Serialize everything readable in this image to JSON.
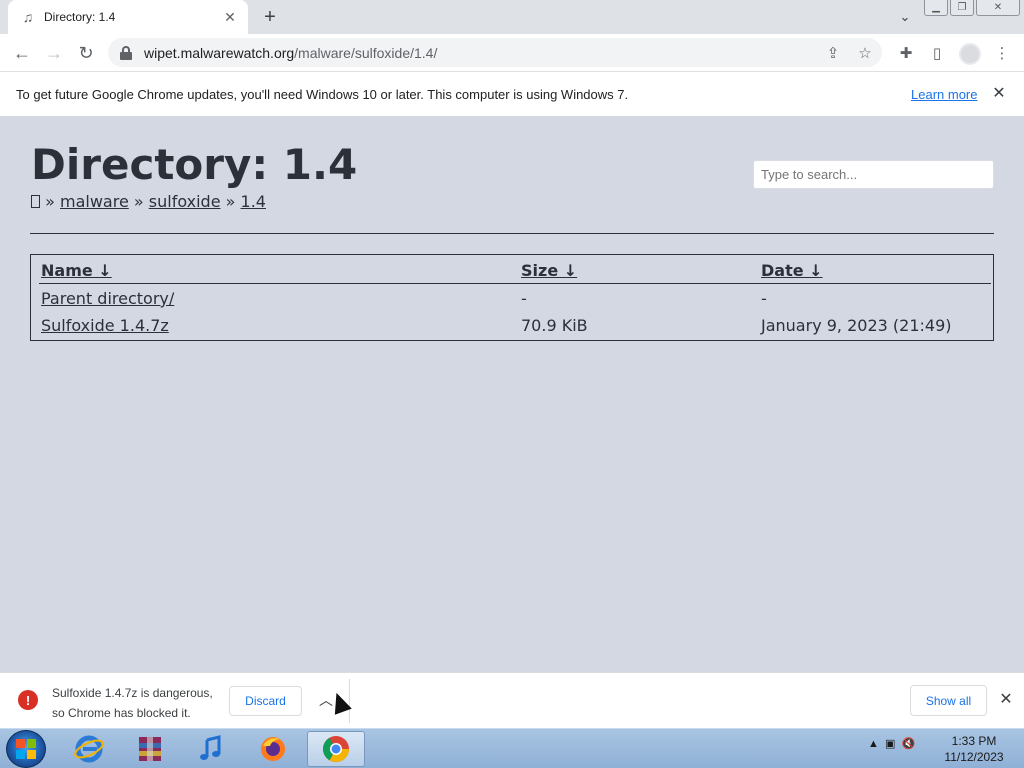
{
  "browser": {
    "tab": {
      "title": "Directory: 1.4"
    },
    "url": {
      "host": "wipet.malwarewatch.org",
      "path": "/malware/sulfoxide/1.4/"
    }
  },
  "infobar": {
    "message": "To get future Google Chrome updates, you'll need Windows 10 or later. This computer is using Windows 7.",
    "link": "Learn more"
  },
  "page": {
    "title": "Directory: 1.4",
    "breadcrumb": {
      "sep": "»",
      "items": [
        "malware",
        "sulfoxide",
        "1.4"
      ]
    },
    "search_placeholder": "Type to search...",
    "table": {
      "headers": {
        "name": "Name ↓",
        "size": "Size ↓",
        "date": "Date ↓"
      },
      "rows": [
        {
          "name": "Parent directory/",
          "size": "-",
          "date": "-"
        },
        {
          "name": "Sulfoxide 1.4.7z",
          "size": "70.9 KiB",
          "date": "January 9, 2023 (21:49)"
        }
      ]
    }
  },
  "download_bar": {
    "message_line1": "Sulfoxide 1.4.7z is dangerous,",
    "message_line2": "so Chrome has blocked it.",
    "discard_label": "Discard",
    "show_all_label": "Show all"
  },
  "taskbar": {
    "time": "1:33 PM",
    "date": "11/12/2023"
  },
  "icons": [
    "music-note-icon",
    "close-icon",
    "plus-icon",
    "chevron-down-icon",
    "back-arrow-icon",
    "forward-arrow-icon",
    "reload-icon",
    "lock-icon",
    "share-icon",
    "star-icon",
    "puzzle-icon",
    "side-panel-icon",
    "profile-avatar",
    "more-vert-icon",
    "warning-icon",
    "chevron-up-icon"
  ]
}
